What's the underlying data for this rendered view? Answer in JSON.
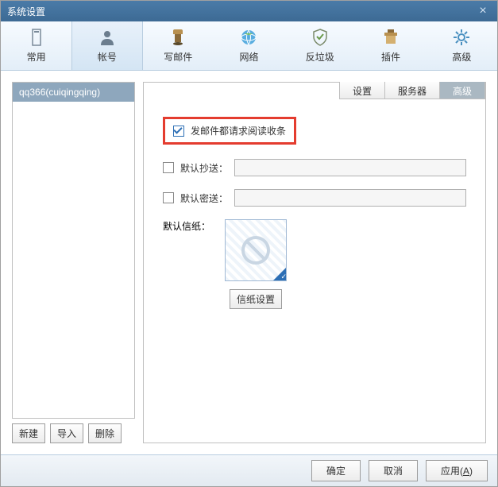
{
  "window": {
    "title": "系统设置"
  },
  "toolbar": {
    "items": [
      {
        "label": "常用"
      },
      {
        "label": "帐号"
      },
      {
        "label": "写邮件"
      },
      {
        "label": "网络"
      },
      {
        "label": "反垃圾"
      },
      {
        "label": "插件"
      },
      {
        "label": "高级"
      }
    ]
  },
  "sidebar": {
    "accounts": [
      "qq366(cuiqingqing)"
    ],
    "buttons": {
      "new": "新建",
      "import": "导入",
      "delete": "删除"
    }
  },
  "tabs": {
    "settings": "设置",
    "server": "服务器",
    "advanced": "高级"
  },
  "content": {
    "read_receipt": "发邮件都请求阅读收条",
    "default_cc": "默认抄送：",
    "default_bcc": "默认密送：",
    "default_stationery": "默认信纸：",
    "stationery_settings": "信纸设置"
  },
  "footer": {
    "ok": "确定",
    "cancel": "取消",
    "apply": "应用(",
    "apply_key": "A",
    "apply_suffix": ")"
  }
}
